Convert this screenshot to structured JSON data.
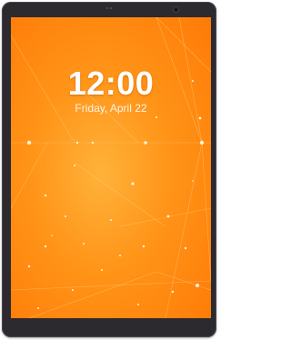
{
  "lockscreen": {
    "time": "12:00",
    "date": "Friday, April 22"
  },
  "colors": {
    "wallpaper_center": "#ffb23a",
    "wallpaper_edge": "#ff7a07",
    "bezel": "#2c2a2e"
  }
}
